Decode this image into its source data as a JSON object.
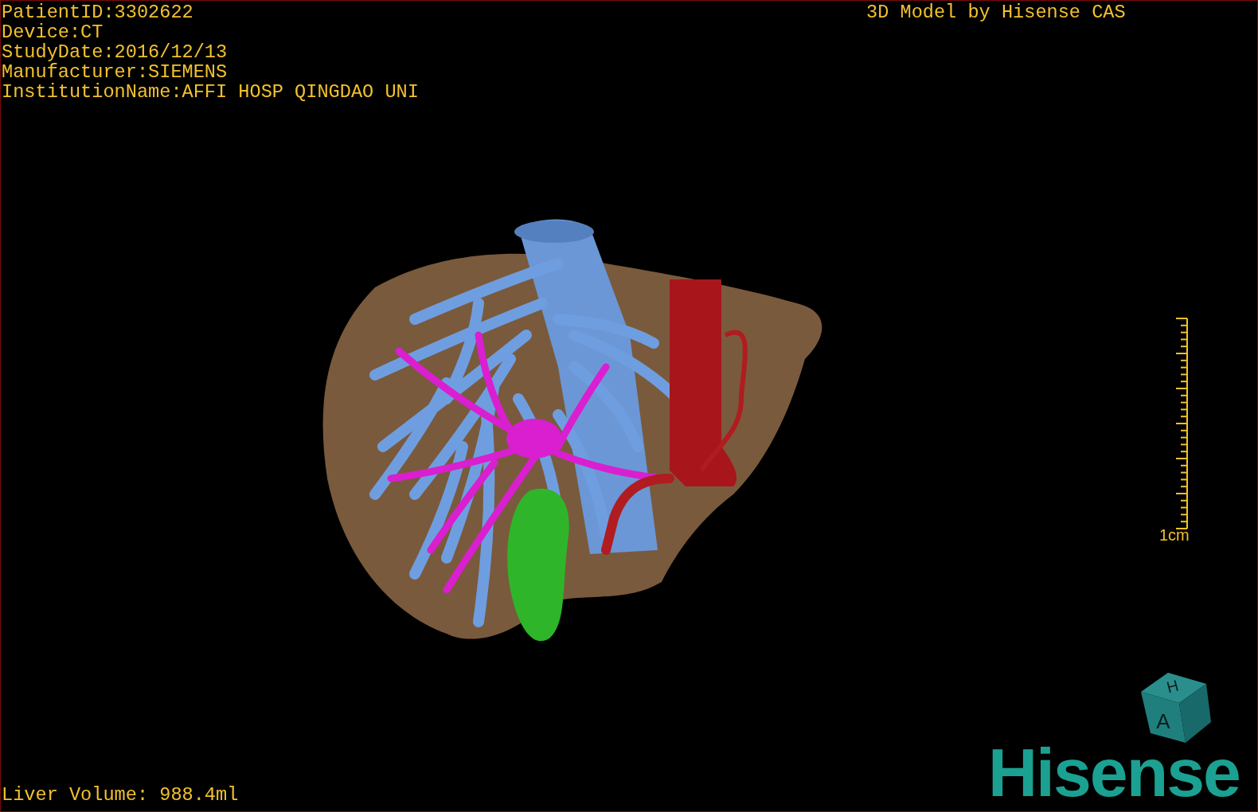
{
  "patient_info": [
    "PatientID:3302622",
    "Device:CT",
    "StudyDate:2016/12/13",
    "Manufacturer:SIEMENS",
    "InstitutionName:AFFI HOSP QINGDAO UNI"
  ],
  "title": "3D Model by Hisense CAS",
  "scale_bar": {
    "label": "1cm"
  },
  "orientation_cube": {
    "faces": [
      "H",
      "A"
    ]
  },
  "liver_volume": "Liver Volume: 988.4ml",
  "logo": "Hisense"
}
